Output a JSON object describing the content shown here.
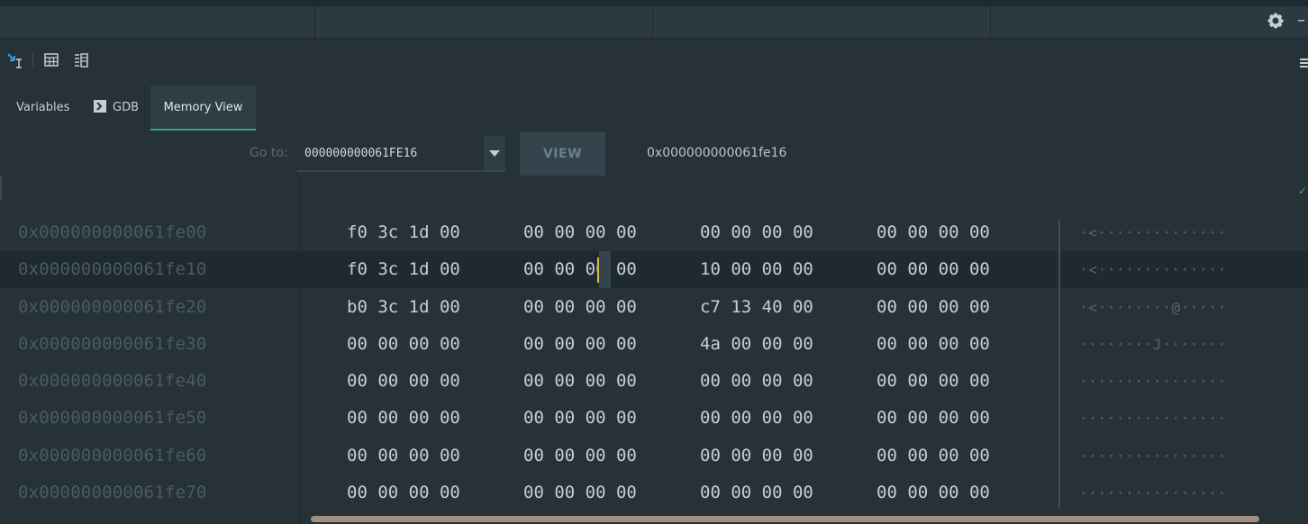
{
  "toolbar": {
    "icons": [
      "step-into-cursor-icon",
      "table-icon",
      "list-layout-icon"
    ]
  },
  "tabs": [
    {
      "label": "Variables",
      "active": false
    },
    {
      "label": "GDB",
      "active": false,
      "icon": "terminal-icon"
    },
    {
      "label": "Memory View",
      "active": true
    }
  ],
  "goto": {
    "label": "Go to:",
    "value": "000000000061FE16",
    "button": "VIEW",
    "resolved": "0x000000000061fe16"
  },
  "memory": {
    "rows": [
      {
        "address": "0x000000000061fe00",
        "groups": [
          "f0 3c 1d 00",
          "00 00 00 00",
          "00 00 00 00",
          "00 00 00 00"
        ],
        "ascii": "·<··············"
      },
      {
        "address": "0x000000000061fe10",
        "groups": [
          "f0 3c 1d 00",
          "00 00 00 00",
          "10 00 00 00",
          "00 00 00 00"
        ],
        "ascii": "·<··············",
        "highlight": true
      },
      {
        "address": "0x000000000061fe20",
        "groups": [
          "b0 3c 1d 00",
          "00 00 00 00",
          "c7 13 40 00",
          "00 00 00 00"
        ],
        "ascii": "·<········@·····"
      },
      {
        "address": "0x000000000061fe30",
        "groups": [
          "00 00 00 00",
          "00 00 00 00",
          "4a 00 00 00",
          "00 00 00 00"
        ],
        "ascii": "········J·······"
      },
      {
        "address": "0x000000000061fe40",
        "groups": [
          "00 00 00 00",
          "00 00 00 00",
          "00 00 00 00",
          "00 00 00 00"
        ],
        "ascii": "················"
      },
      {
        "address": "0x000000000061fe50",
        "groups": [
          "00 00 00 00",
          "00 00 00 00",
          "00 00 00 00",
          "00 00 00 00"
        ],
        "ascii": "················"
      },
      {
        "address": "0x000000000061fe60",
        "groups": [
          "00 00 00 00",
          "00 00 00 00",
          "00 00 00 00",
          "00 00 00 00"
        ],
        "ascii": "················"
      },
      {
        "address": "0x000000000061fe70",
        "groups": [
          "00 00 00 00",
          "00 00 00 00",
          "00 00 00 00",
          "00 00 00 00"
        ],
        "ascii": "················"
      }
    ]
  },
  "colors": {
    "accent": "#26a69a",
    "caret": "#e0b64a",
    "background": "#263238"
  }
}
